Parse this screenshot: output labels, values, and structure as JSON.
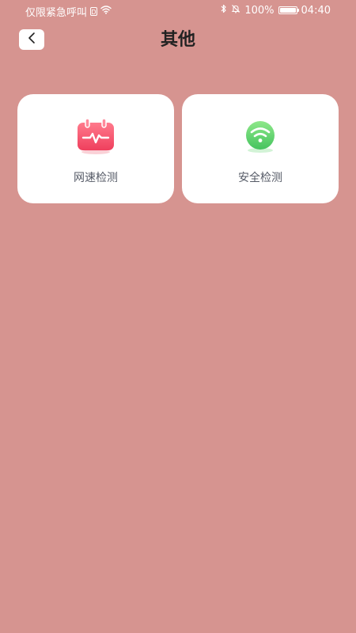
{
  "status_bar": {
    "carrier_text": "仅限紧急呼叫",
    "sim_badge": "D",
    "battery_text": "100%",
    "battery_level": 1.0,
    "time": "04:40",
    "icons": [
      "wifi-icon",
      "bluetooth-icon",
      "mute-icon",
      "battery-icon"
    ]
  },
  "header": {
    "title": "其他",
    "back_icon": "chevron-left-icon"
  },
  "cards": [
    {
      "label": "网速检测",
      "icon": "speed-test-icon",
      "icon_color": "#f0566e"
    },
    {
      "label": "安全检测",
      "icon": "wifi-security-icon",
      "icon_color": "#5cd46e"
    }
  ],
  "colors": {
    "background": "#d69490",
    "card": "#ffffff",
    "title": "#222222",
    "label": "#555a66"
  }
}
